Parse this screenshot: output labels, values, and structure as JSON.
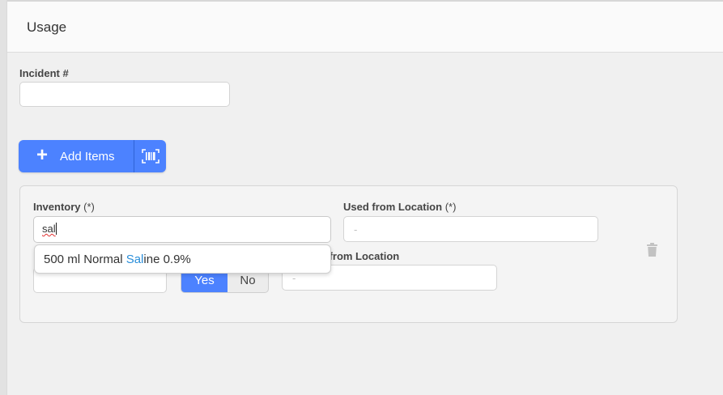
{
  "header": {
    "title": "Usage"
  },
  "incident": {
    "label": "Incident #",
    "value": ""
  },
  "add_items": {
    "label": "Add Items",
    "plus_icon": "plus-icon",
    "barcode_icon": "barcode-icon"
  },
  "item": {
    "inventory": {
      "label": "Inventory",
      "required_mark": "(*)",
      "value": "sal"
    },
    "suggestion": {
      "prefix": "500 ml Normal ",
      "match": "Sal",
      "suffix": "ine 0.9%"
    },
    "used_from": {
      "label": "Used from Location",
      "required_mark": "(*)",
      "placeholder": "-"
    },
    "partial_label": "d from Location",
    "toggle": {
      "yes": "Yes",
      "no": "No",
      "selected": "Yes"
    },
    "second_location": {
      "placeholder": "-"
    },
    "delete_icon": "trash-icon"
  },
  "colors": {
    "accent": "#4c82ff",
    "highlight": "#2a8ed9"
  }
}
